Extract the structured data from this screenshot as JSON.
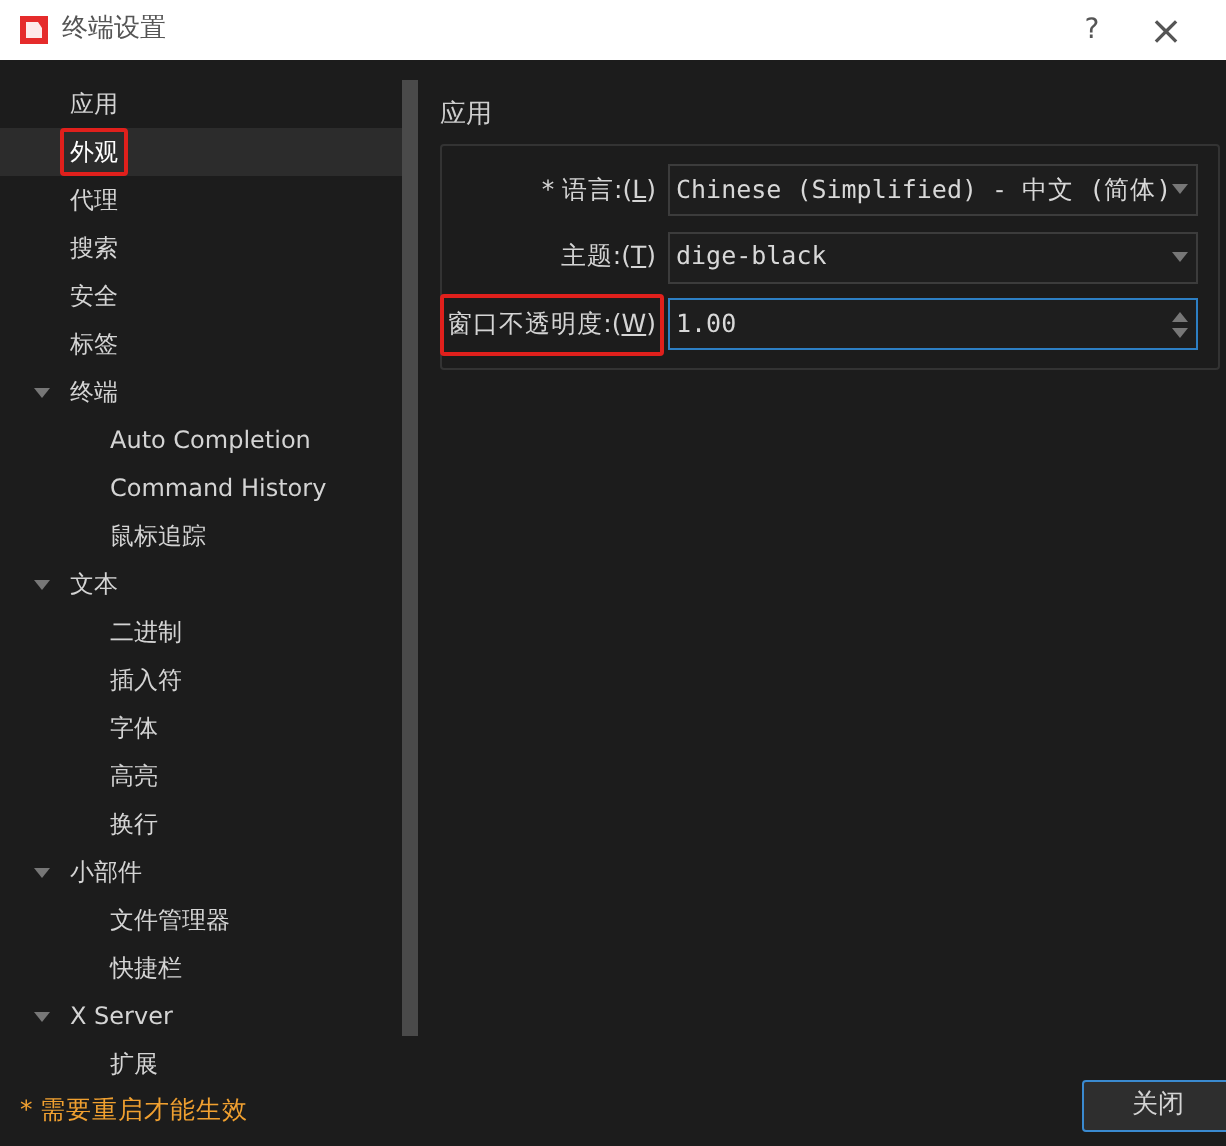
{
  "window": {
    "title": "终端设置",
    "help": "?",
    "close": "×"
  },
  "sidebar": {
    "items": [
      {
        "label": "应用",
        "selected": false,
        "highlighted": false
      },
      {
        "label": "外观",
        "selected": true,
        "highlighted": true
      },
      {
        "label": "代理",
        "selected": false,
        "highlighted": false
      },
      {
        "label": "搜索",
        "selected": false,
        "highlighted": false
      },
      {
        "label": "安全",
        "selected": false,
        "highlighted": false
      },
      {
        "label": "标签",
        "selected": false,
        "highlighted": false
      },
      {
        "label": "终端",
        "selected": false,
        "highlighted": false,
        "expanded": true,
        "children": [
          {
            "label": "Auto Completion",
            "selected": false,
            "highlighted": false
          },
          {
            "label": "Command History",
            "selected": false,
            "highlighted": false
          },
          {
            "label": "鼠标追踪",
            "selected": false,
            "highlighted": false
          }
        ]
      },
      {
        "label": "文本",
        "selected": false,
        "highlighted": false,
        "expanded": true,
        "children": [
          {
            "label": "二进制",
            "selected": false,
            "highlighted": false
          },
          {
            "label": "插入符",
            "selected": false,
            "highlighted": false
          },
          {
            "label": "字体",
            "selected": false,
            "highlighted": false
          },
          {
            "label": "高亮",
            "selected": false,
            "highlighted": false
          },
          {
            "label": "换行",
            "selected": false,
            "highlighted": false
          }
        ]
      },
      {
        "label": "小部件",
        "selected": false,
        "highlighted": false,
        "expanded": true,
        "children": [
          {
            "label": "文件管理器",
            "selected": false,
            "highlighted": false
          },
          {
            "label": "快捷栏",
            "selected": false,
            "highlighted": false
          }
        ]
      },
      {
        "label": "X Server",
        "selected": false,
        "highlighted": false,
        "expanded": true,
        "children": [
          {
            "label": "扩展",
            "selected": false,
            "highlighted": false
          }
        ]
      }
    ],
    "footnote": "* 需要重启才能生效"
  },
  "panel": {
    "title": "应用",
    "fields": [
      {
        "kind": "dropdown",
        "label_before": "* 语言:(",
        "mnemonic": "L",
        "label_after": ")",
        "value": "Chinese (Simplified) - 中文 (简体)",
        "highlighted": false,
        "focused": false
      },
      {
        "kind": "dropdown",
        "label_before": "主题:(",
        "mnemonic": "T",
        "label_after": ")",
        "value": "dige-black",
        "highlighted": false,
        "focused": false
      },
      {
        "kind": "spinbox",
        "label_before": "窗口不透明度:(",
        "mnemonic": "W",
        "label_after": ")",
        "value": "1.00",
        "highlighted": true,
        "focused": true
      }
    ]
  },
  "buttons": [
    {
      "label": "关闭",
      "focused": true
    }
  ]
}
